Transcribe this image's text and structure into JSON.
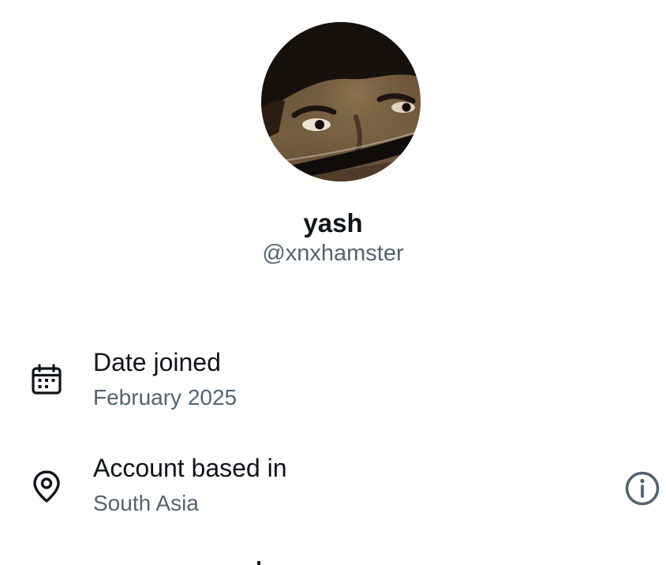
{
  "profile": {
    "display_name": "yash",
    "handle": "@xnxhamster",
    "avatar_icon": "profile-photo"
  },
  "about": {
    "date_joined": {
      "label": "Date joined",
      "value": "February 2025",
      "icon": "calendar-icon"
    },
    "account_location": {
      "label": "Account based in",
      "value": "South Asia",
      "icon": "location-pin-icon",
      "action_icon": "info-icon"
    }
  },
  "colors": {
    "primary_text": "#0f1419",
    "secondary_text": "#536471",
    "background": "#ffffff"
  }
}
